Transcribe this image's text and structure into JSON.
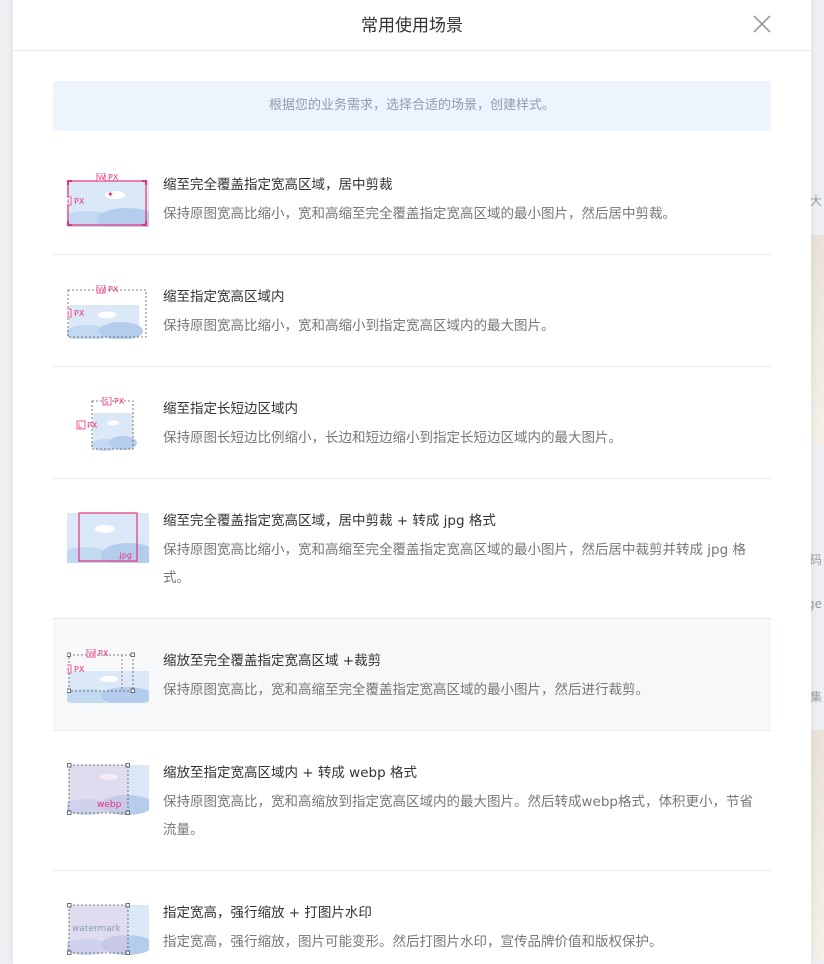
{
  "modal": {
    "title": "常用使用场景",
    "tip": "根据您的业务需求，选择合适的场景，创建样式。"
  },
  "background_fragments": [
    "大",
    "码",
    "ge",
    "集"
  ],
  "colors": {
    "accent": "#e8317b",
    "tip_bg": "#eef4fd",
    "tip_text": "#8c9bb4"
  },
  "scenes": [
    {
      "title": "缩至完全覆盖指定宽高区域，居中剪裁",
      "desc": "保持原图宽高比缩小，宽和高缩至完全覆盖指定宽高区域的最小图片，然后居中剪裁。",
      "icon": "crop-center-icon",
      "tags": [
        "W",
        "PX",
        "H",
        "PX"
      ]
    },
    {
      "title": "缩至指定宽高区域内",
      "desc": "保持原图宽高比缩小，宽和高缩小到指定宽高区域内的最大图片。",
      "icon": "fit-inside-icon",
      "tags": [
        "W",
        "PX",
        "H",
        "PX"
      ]
    },
    {
      "title": "缩至指定长短边区域内",
      "desc": "保持原图长短边比例缩小，长边和短边缩小到指定长短边区域内的最大图片。",
      "icon": "long-short-edge-icon",
      "tags": [
        "S",
        "PX",
        "L",
        "PX"
      ]
    },
    {
      "title": "缩至完全覆盖指定宽高区域，居中剪裁 + 转成 jpg 格式",
      "desc": "保持原图宽高比缩小，宽和高缩至完全覆盖指定宽高区域的最小图片，然后居中裁剪并转成 jpg 格式。",
      "icon": "crop-jpg-icon",
      "tags": [
        ".jpg"
      ]
    },
    {
      "title": "缩放至完全覆盖指定宽高区域 +裁剪",
      "desc": "保持原图宽高比，宽和高缩至完全覆盖指定宽高区域的最小图片，然后进行裁剪。",
      "icon": "scale-crop-icon",
      "tags": [
        "W",
        "PX",
        "H",
        "PX"
      ]
    },
    {
      "title": "缩放至指定宽高区域内 + 转成 webp 格式",
      "desc": "保持原图宽高比，宽和高缩放到指定宽高区域内的最大图片。然后转成webp格式，体积更小，节省流量。",
      "icon": "webp-icon",
      "tags": [
        "webp"
      ]
    },
    {
      "title": "指定宽高，强行缩放 + 打图片水印",
      "desc": "指定宽高，强行缩放，图片可能变形。然后打图片水印，宣传品牌价值和版权保护。",
      "icon": "watermark-icon",
      "tags": [
        "watermark"
      ]
    }
  ]
}
